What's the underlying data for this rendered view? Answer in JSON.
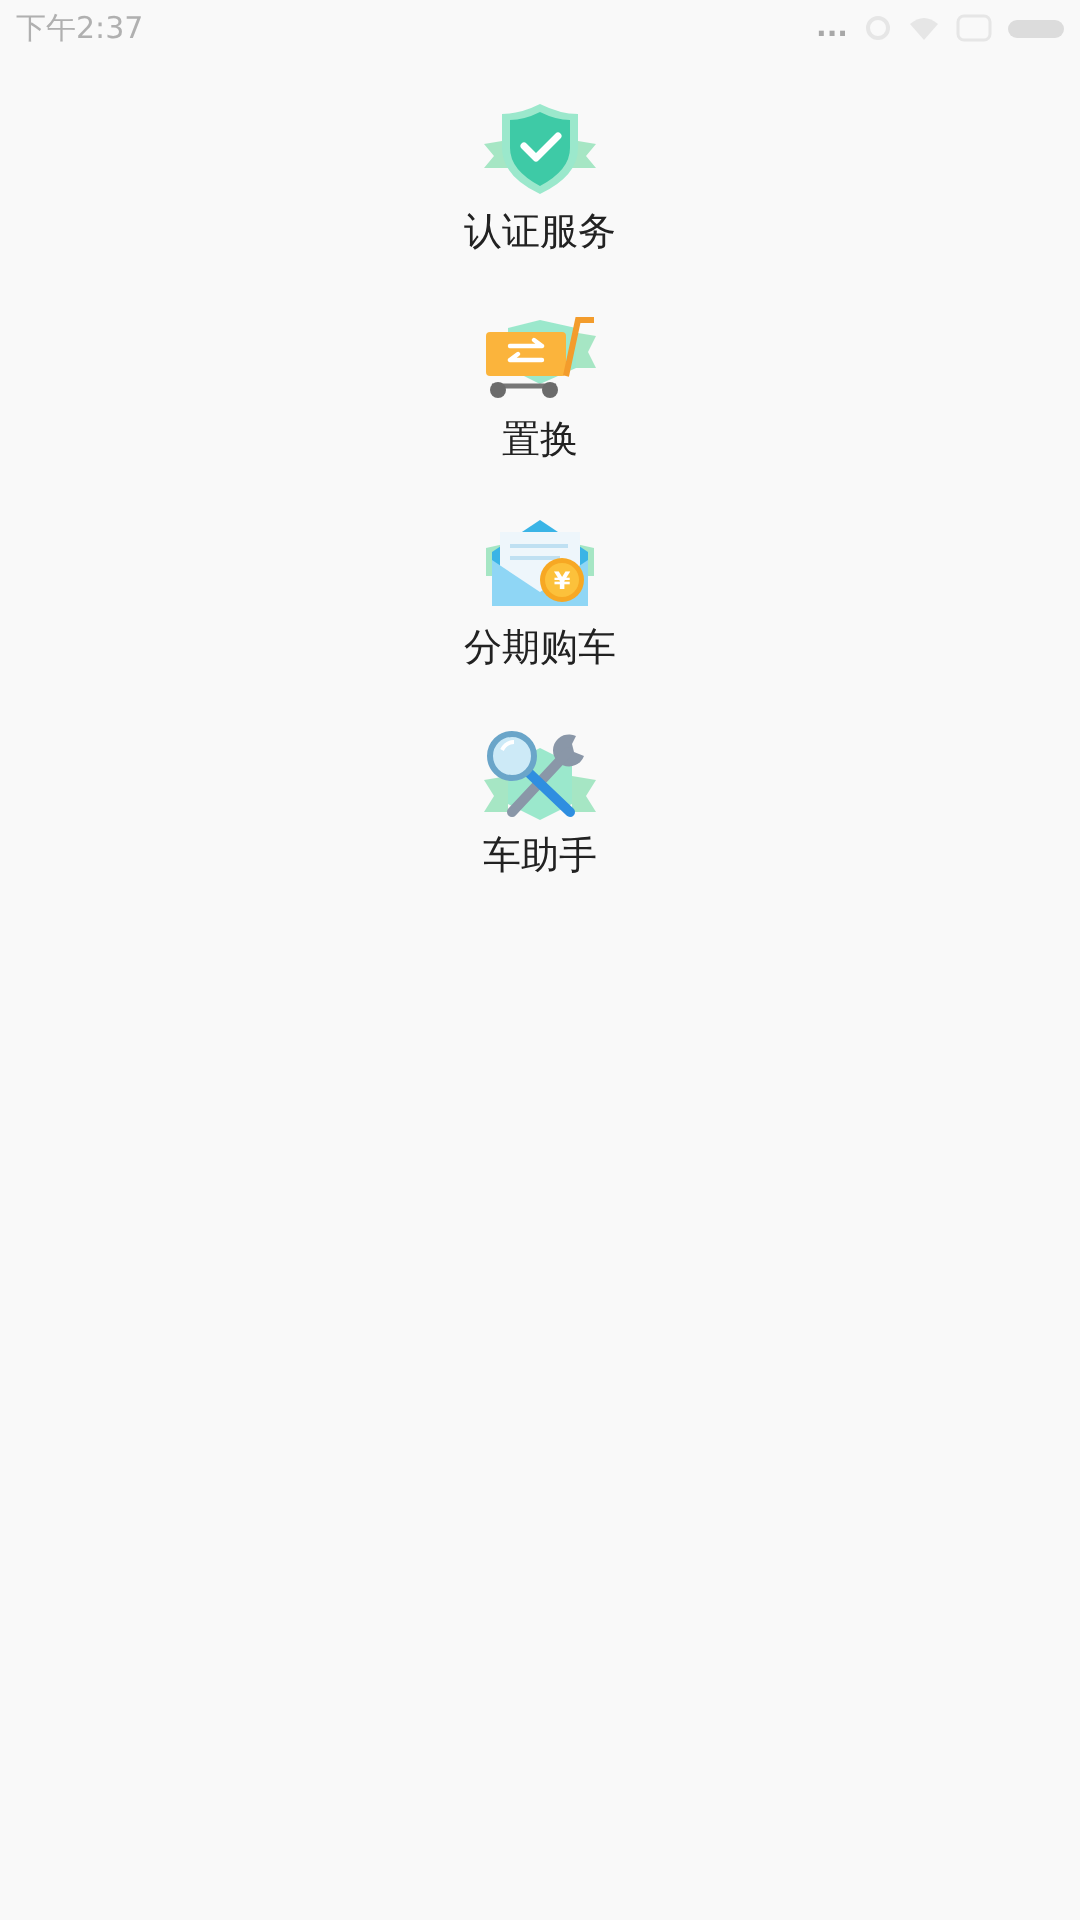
{
  "status_bar": {
    "time": "下午2:37",
    "signal_dots": "..."
  },
  "services": [
    {
      "kind": "shield",
      "label": "认证服务"
    },
    {
      "kind": "cart",
      "label": "置换"
    },
    {
      "kind": "envelope",
      "label": "分期购车",
      "coin_symbol": "¥"
    },
    {
      "kind": "tools",
      "label": "车助手"
    }
  ]
}
